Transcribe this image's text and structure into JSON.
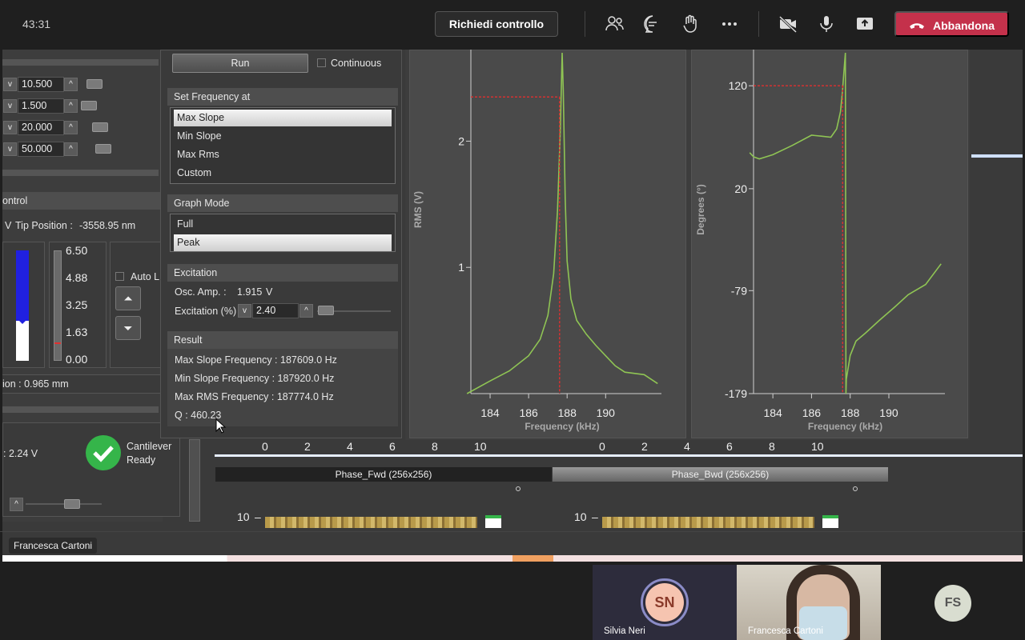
{
  "teams": {
    "timer": "43:31",
    "request_control": "Richiedi controllo",
    "leave": "Abbandona",
    "shared_by_tag": "Francesca Cartoni",
    "participants": [
      {
        "initials": "SN",
        "name": "Silvia Neri"
      },
      {
        "initials": "",
        "name": "Francesca Cartoni"
      },
      {
        "initials": "FS",
        "name": ""
      }
    ]
  },
  "left_panel": {
    "params": [
      "10.500",
      "1.500",
      "20.000",
      "50.000"
    ],
    "control_header": "ontrol",
    "tip_position_label": "Tip Position :",
    "tip_position_v": "V",
    "tip_position_value": "-3558.95 nm",
    "scale_ticks": [
      "6.50",
      "4.88",
      "3.25",
      "1.63",
      "0.00"
    ],
    "auto_label": "Auto L",
    "position_readout": "ion : 0.965 mm",
    "voltage_readout": ": 2.24 V",
    "cantilever_status": "Cantilever\nReady",
    "cantilever_line1": "Cantilever",
    "cantilever_line2": "Ready"
  },
  "tuning": {
    "run": "Run",
    "continuous": "Continuous",
    "set_freq_header": "Set Frequency at",
    "set_freq_options": [
      "Max Slope",
      "Min Slope",
      "Max Rms",
      "Custom"
    ],
    "set_freq_selected": "Max Slope",
    "graph_mode_header": "Graph Mode",
    "graph_mode_options": [
      "Full",
      "Peak"
    ],
    "graph_mode_selected": "Peak",
    "excitation_header": "Excitation",
    "osc_amp_label": "Osc. Amp. :",
    "osc_amp_value": "1.915",
    "osc_amp_unit": "V",
    "excitation_label": "Excitation (%)",
    "excitation_value": "2.40",
    "result_header": "Result",
    "max_slope_freq": "Max Slope Frequency : 187609.0 Hz",
    "min_slope_freq": "Min Slope Frequency : 187920.0 Hz",
    "max_rms_freq": "Max RMS Frequency : 187774.0 Hz",
    "q_value": "Q : 460.23"
  },
  "chart_data": [
    {
      "type": "line",
      "ylabel": "RMS (V)",
      "xlabel": "Frequency (kHz)",
      "x_ticks": [
        "184",
        "186",
        "188",
        "190"
      ],
      "y_ticks": [
        "2",
        "1"
      ],
      "xlim": [
        183,
        192.9
      ],
      "ylim": [
        0,
        2.7
      ],
      "series": [
        {
          "x": [
            182.8,
            184,
            185,
            186,
            186.6,
            187.0,
            187.3,
            187.5,
            187.65,
            187.74,
            187.8,
            187.9,
            188.0,
            188.2,
            188.5,
            189.0,
            189.5,
            190.0,
            190.5,
            191.0,
            192.0,
            192.7
          ],
          "y": [
            0.0,
            0.1,
            0.18,
            0.3,
            0.43,
            0.62,
            0.95,
            1.45,
            2.1,
            2.7,
            2.4,
            1.55,
            1.05,
            0.75,
            0.58,
            0.47,
            0.38,
            0.3,
            0.22,
            0.17,
            0.15,
            0.08
          ]
        }
      ],
      "markers": {
        "x": 187.609,
        "y": 2.35
      }
    },
    {
      "type": "line",
      "ylabel": "Degrees (°)",
      "xlabel": "Frequency (kHz)",
      "x_ticks": [
        "184",
        "186",
        "188",
        "190"
      ],
      "y_ticks": [
        "120",
        "20",
        "-79",
        "-179"
      ],
      "xlim": [
        183,
        192.9
      ],
      "ylim": [
        -179,
        152
      ],
      "series": [
        {
          "x": [
            182.8,
            183.0,
            183.3,
            184.0,
            185.0,
            186.0,
            186.5,
            187.0,
            187.3,
            187.5,
            187.6,
            187.7,
            187.75,
            187.78,
            187.8,
            188.0,
            188.3,
            188.8,
            189.5,
            190.3,
            191.0,
            191.9,
            192.7
          ],
          "y": [
            55,
            51,
            49,
            53,
            62,
            72,
            71,
            70,
            78,
            95,
            115,
            140,
            152,
            -179,
            -165,
            -142,
            -128,
            -120,
            -108,
            -95,
            -83,
            -73,
            -53
          ]
        }
      ],
      "markers": {
        "x": 187.609,
        "y": 120
      }
    }
  ],
  "bottom": {
    "axis_ticks": [
      "0",
      "2",
      "4",
      "6",
      "8",
      "10"
    ],
    "channel_fwd": "Phase_Fwd (256x256)",
    "channel_bwd": "Phase_Bwd (256x256)",
    "scale_label": "10"
  },
  "colors": {
    "curve": "#8fc454",
    "marker": "#e03030",
    "leave": "#c4314b",
    "ready_green": "#35b54a"
  }
}
